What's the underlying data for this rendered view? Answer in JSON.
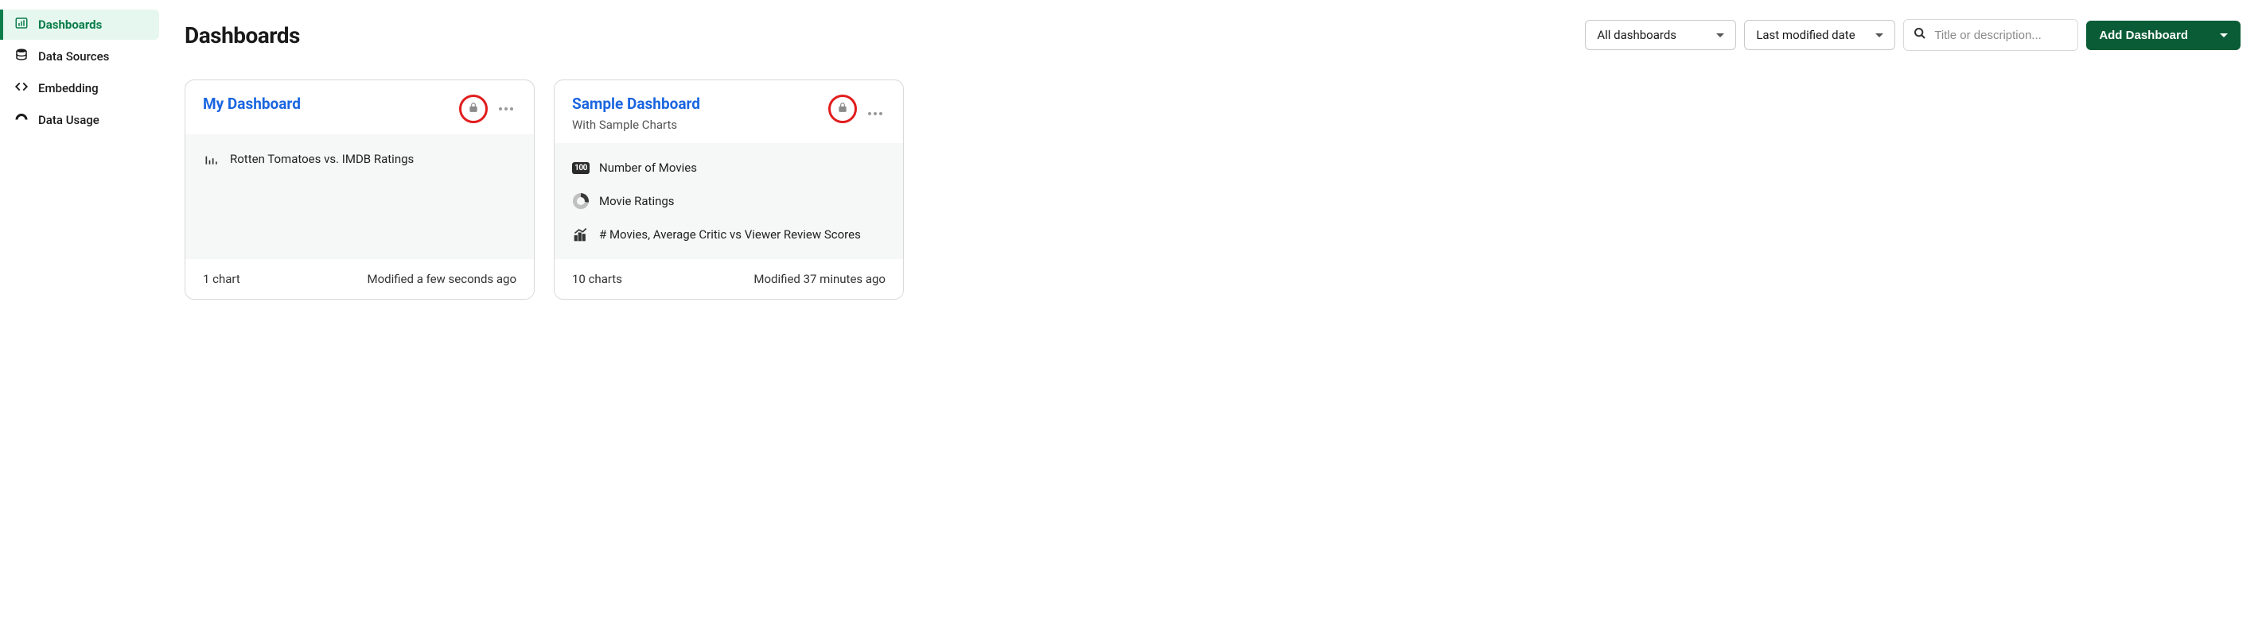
{
  "sidebar": {
    "items": [
      {
        "label": "Dashboards"
      },
      {
        "label": "Data Sources"
      },
      {
        "label": "Embedding"
      },
      {
        "label": "Data Usage"
      }
    ]
  },
  "header": {
    "title": "Dashboards",
    "filter_label": "All dashboards",
    "sort_label": "Last modified date",
    "search_placeholder": "Title or description...",
    "add_button_label": "Add Dashboard"
  },
  "cards": [
    {
      "title": "My Dashboard",
      "subtitle": "",
      "contents": [
        {
          "kind": "bars",
          "label": "Rotten Tomatoes vs. IMDB Ratings"
        }
      ],
      "chart_count": "1 chart",
      "modified": "Modified a few seconds ago"
    },
    {
      "title": "Sample Dashboard",
      "subtitle": "With Sample Charts",
      "contents": [
        {
          "kind": "metric",
          "label": "Number of Movies"
        },
        {
          "kind": "donut",
          "label": "Movie Ratings"
        },
        {
          "kind": "combo",
          "label": "# Movies, Average Critic vs Viewer Review Scores"
        }
      ],
      "chart_count": "10 charts",
      "modified": "Modified 37 minutes ago"
    }
  ]
}
